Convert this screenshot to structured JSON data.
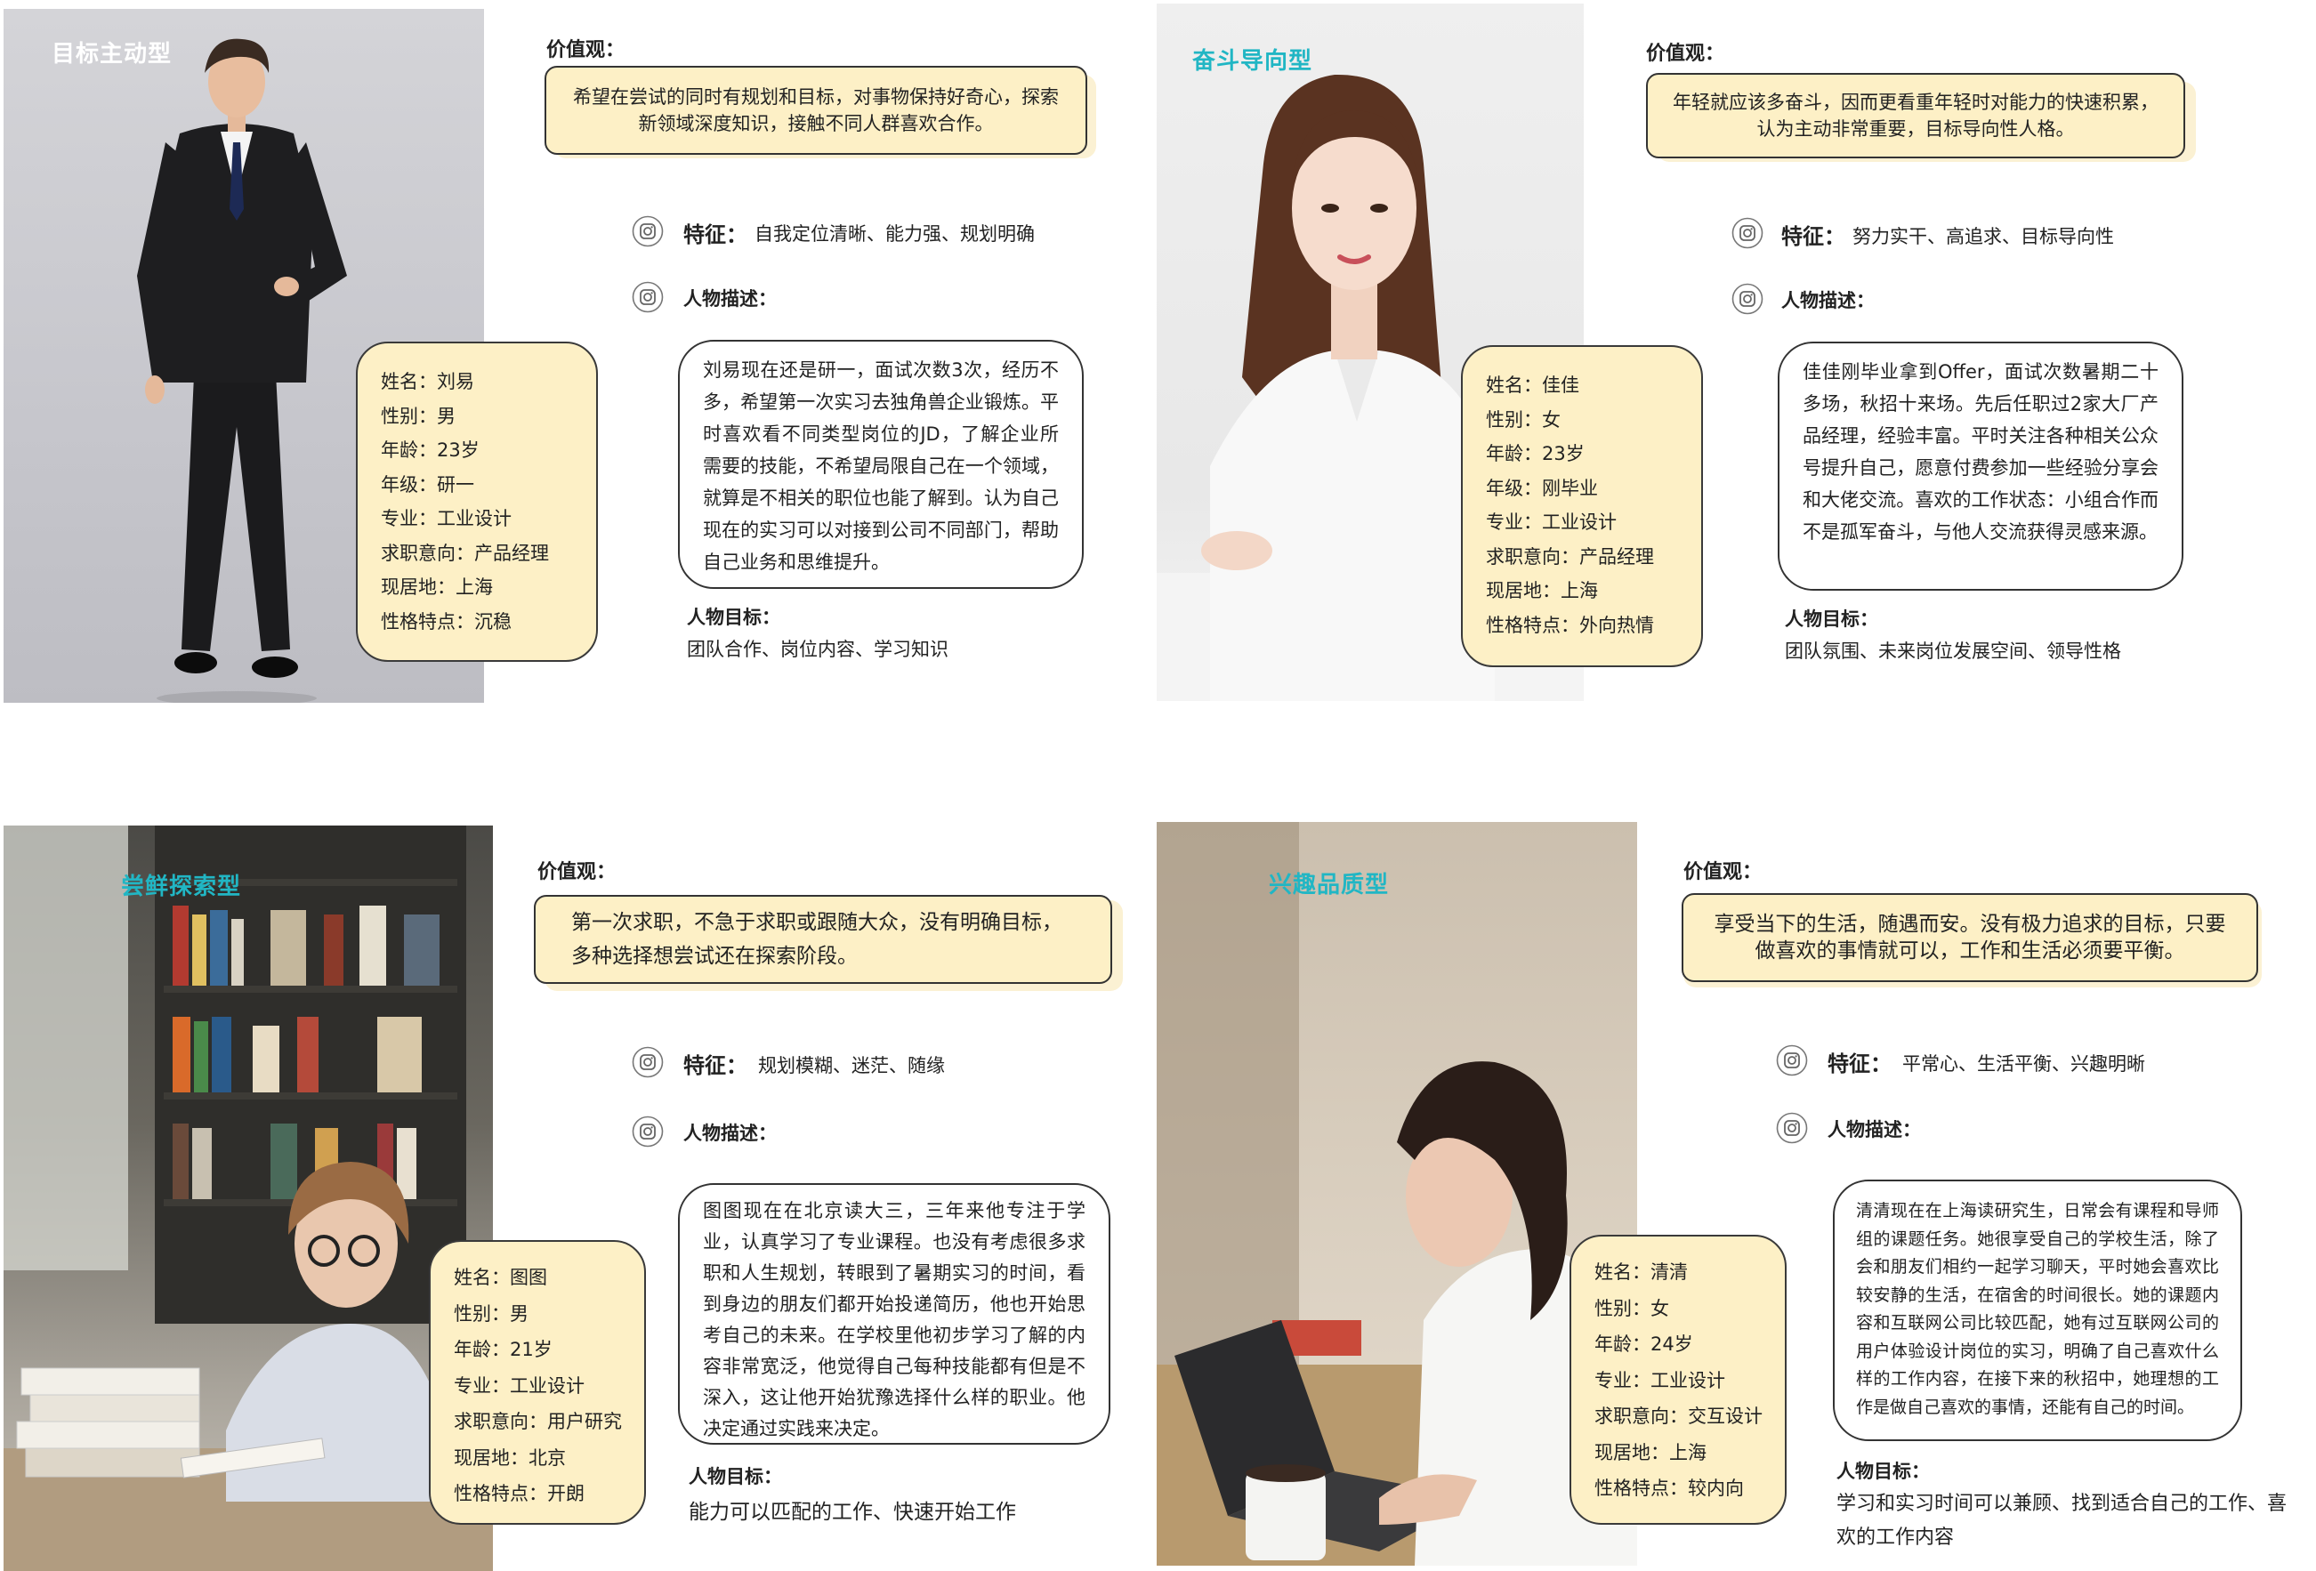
{
  "personas": [
    {
      "type_label": "目标主动型",
      "values_title": "价值观：",
      "values_text": "希望在尝试的同时有规划和目标，对事物保持好奇心，探索新领域深度知识，接触不同人群喜欢合作。",
      "info": [
        "姓名：刘易",
        "性别：男",
        "年龄：23岁",
        "年级：研一",
        "专业：工业设计",
        "求职意向：产品经理",
        "现居地：上海",
        "性格特点：沉稳"
      ],
      "feature_title": "特征：",
      "feature_text": "自我定位清晰、能力强、规划明确",
      "desc_title": "人物描述：",
      "desc_text": "刘易现在还是研一，面试次数3次，经历不多，希望第一次实习去独角兽企业锻炼。平时喜欢看不同类型岗位的JD，了解企业所需要的技能，不希望局限自己在一个领域，就算是不相关的职位也能了解到。认为自己现在的实习可以对接到公司不同部门，帮助自己业务和思维提升。",
      "goal_title": "人物目标：",
      "goal_text": "团队合作、岗位内容、学习知识"
    },
    {
      "type_label": "奋斗导向型",
      "values_title": "价值观：",
      "values_text": "年轻就应该多奋斗，因而更看重年轻时对能力的快速积累，认为主动非常重要，目标导向性人格。",
      "info": [
        "姓名：佳佳",
        "性别：女",
        "年龄：23岁",
        "年级：刚毕业",
        "专业：工业设计",
        "求职意向：产品经理",
        "现居地：上海",
        "性格特点：外向热情"
      ],
      "feature_title": "特征：",
      "feature_text": "努力实干、高追求、目标导向性",
      "desc_title": "人物描述：",
      "desc_text": "佳佳刚毕业拿到Offer，面试次数暑期二十多场，秋招十来场。先后任职过2家大厂产品经理，经验丰富。平时关注各种相关公众号提升自己，愿意付费参加一些经验分享会和大佬交流。喜欢的工作状态：小组合作而不是孤军奋斗，与他人交流获得灵感来源。",
      "goal_title": "人物目标：",
      "goal_text": "团队氛围、未来岗位发展空间、领导性格"
    },
    {
      "type_label": "尝鲜探索型",
      "values_title": "价值观：",
      "values_text": "第一次求职，不急于求职或跟随大众，没有明确目标，多种选择想尝试还在探索阶段。",
      "info": [
        "姓名：图图",
        "性别：男",
        "年龄：21岁",
        "专业：工业设计",
        "求职意向：用户研究",
        "现居地：北京",
        "性格特点：开朗"
      ],
      "feature_title": "特征：",
      "feature_text": "规划模糊、迷茫、随缘",
      "desc_title": "人物描述：",
      "desc_text": "图图现在在北京读大三，三年来他专注于学业，认真学习了专业课程。也没有考虑很多求职和人生规划，转眼到了暑期实习的时间，看到身边的朋友们都开始投递简历，他也开始思考自己的未来。在学校里他初步学习了解的内容非常宽泛，他觉得自己每种技能都有但是不深入，这让他开始犹豫选择什么样的职业。他决定通过实践来决定。",
      "goal_title": "人物目标：",
      "goal_text": "能力可以匹配的工作、快速开始工作"
    },
    {
      "type_label": "兴趣品质型",
      "values_title": "价值观：",
      "values_text": "享受当下的生活，随遇而安。没有极力追求的目标，只要做喜欢的事情就可以，工作和生活必须要平衡。",
      "info": [
        "姓名：清清",
        "性别：女",
        "年龄：24岁",
        "专业：工业设计",
        "求职意向：交互设计",
        "现居地：上海",
        "性格特点：较内向"
      ],
      "feature_title": "特征：",
      "feature_text": "平常心、生活平衡、兴趣明晰",
      "desc_title": "人物描述：",
      "desc_text": "清清现在在上海读研究生，日常会有课程和导师组的课题任务。她很享受自己的学校生活，除了会和朋友们相约一起学习聊天，平时她会喜欢比较安静的生活，在宿舍的时间很长。她的课题内容和互联网公司比较匹配，她有过互联网公司的用户体验设计岗位的实习，明确了自己喜欢什么样的工作内容，在接下来的秋招中，她理想的工作是做自己喜欢的事情，还能有自己的时间。",
      "goal_title": "人物目标：",
      "goal_text": "学习和实习时间可以兼顾、找到适合自己的工作、喜欢的工作内容"
    }
  ],
  "colors": {
    "card_fill": "#fdf0c6",
    "label_teal": "#21b6c4",
    "border": "#333333"
  }
}
